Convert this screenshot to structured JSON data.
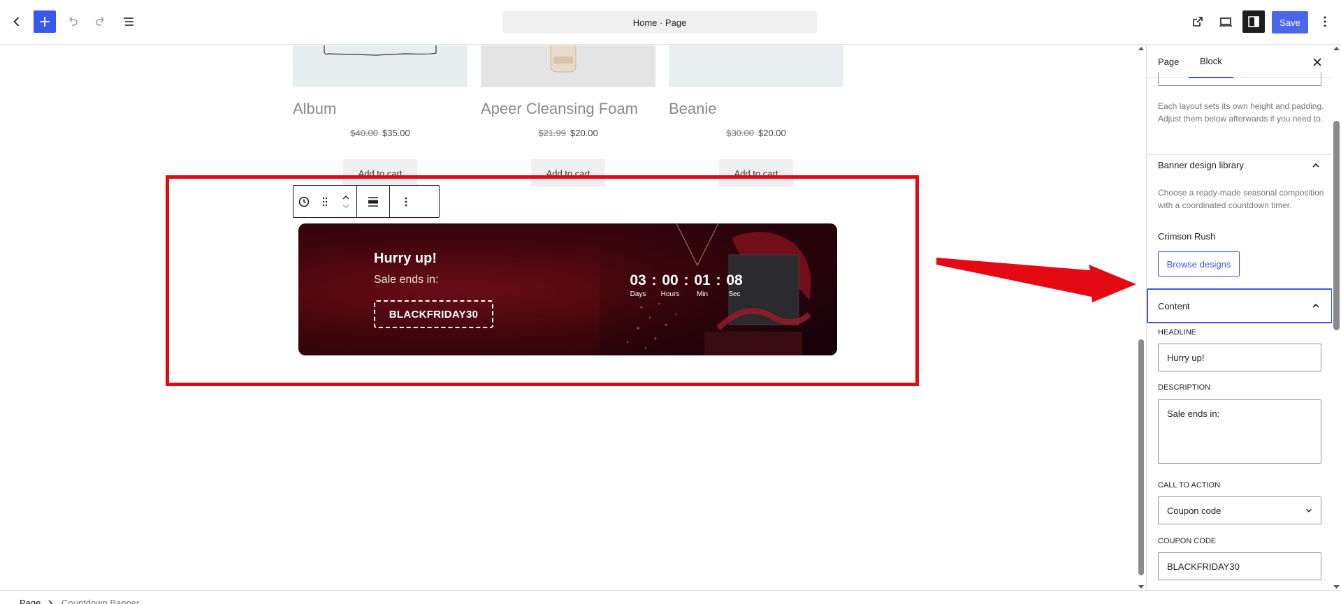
{
  "topbar": {
    "title": "Home · Page",
    "save_label": "Save",
    "colors": {
      "accent": "#3858e9"
    }
  },
  "canvas": {
    "products": [
      {
        "name": "Album",
        "old_price": "$40.00",
        "price": "$35.00",
        "cart_label": "Add to cart"
      },
      {
        "name": "Apeer Cleansing Foam",
        "old_price": "$21.99",
        "price": "$20.00",
        "cart_label": "Add to cart"
      },
      {
        "name": "Beanie",
        "old_price": "$30.00",
        "price": "$20.00",
        "cart_label": "Add to cart"
      }
    ],
    "banner": {
      "headline": "Hurry up!",
      "description": "Sale ends in:",
      "coupon": "BLACKFRIDAY30",
      "countdown": [
        {
          "value": "03",
          "label": "Days"
        },
        {
          "value": "00",
          "label": "Hours"
        },
        {
          "value": "01",
          "label": "Min"
        },
        {
          "value": "08",
          "label": "Sec"
        }
      ],
      "separator": ":",
      "colors": {
        "background": "#3d050c",
        "text": "#ffffff"
      }
    },
    "annotation_color": "#e50914"
  },
  "sidebar": {
    "tabs": {
      "page": "Page",
      "block": "Block"
    },
    "layout_help": "Each layout sets its own height and padding. Adjust them below afterwards if you need to.",
    "library": {
      "title": "Banner design library",
      "help": "Choose a ready-made seasonal composition with a coordinated countdown timer.",
      "current_design": "Crimson Rush",
      "browse_label": "Browse designs"
    },
    "content": {
      "title": "Content",
      "headline_label": "HEADLINE",
      "headline_value": "Hurry up!",
      "description_label": "DESCRIPTION",
      "description_value": "Sale ends in:",
      "cta_label": "CALL TO ACTION",
      "cta_value": "Coupon code",
      "coupon_label": "COUPON CODE",
      "coupon_value": "BLACKFRIDAY30"
    }
  },
  "footer": {
    "breadcrumbs": [
      "Page",
      "Countdown Banner"
    ]
  }
}
